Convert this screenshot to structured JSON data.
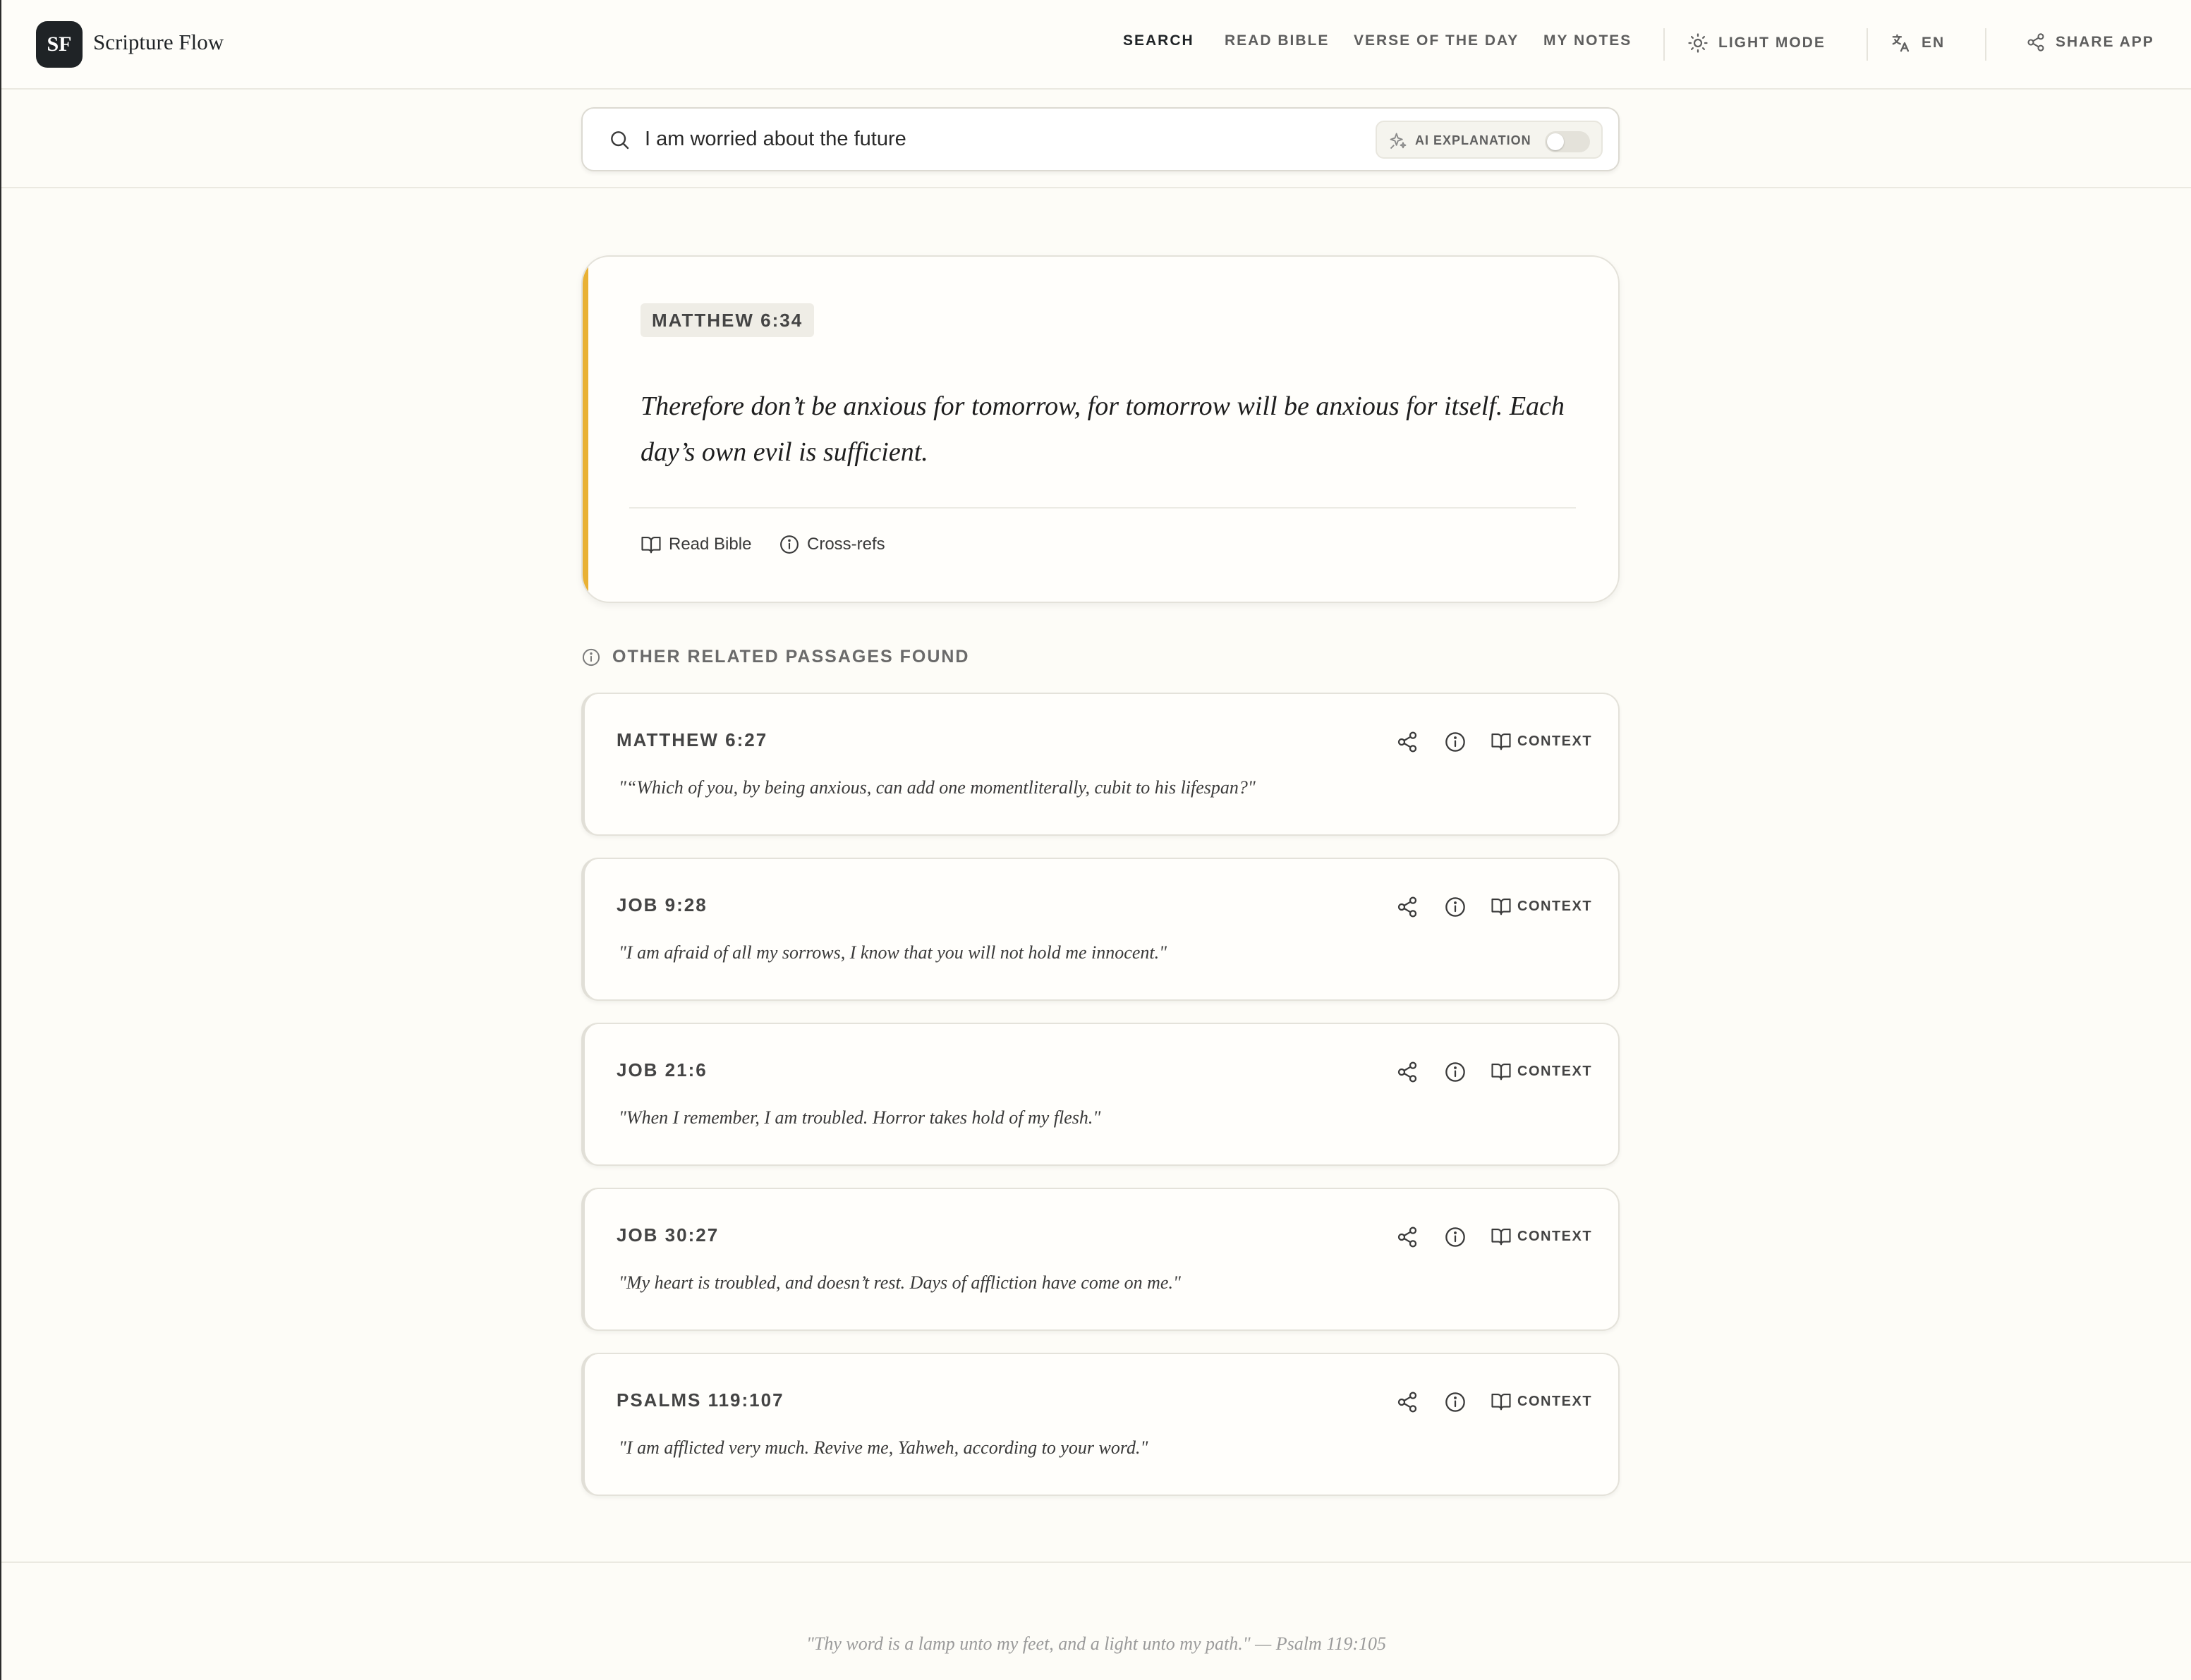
{
  "app": {
    "logo_initials": "SF",
    "name": "Scripture Flow"
  },
  "nav": {
    "search": "SEARCH",
    "read_bible": "READ BIBLE",
    "verse_of_day": "VERSE OF THE DAY",
    "my_notes": "MY NOTES",
    "theme": "LIGHT MODE",
    "language": "EN",
    "share_app": "SHARE APP"
  },
  "search": {
    "query": "I am worried about the future",
    "ai_toggle_label": "AI EXPLANATION",
    "ai_toggle_on": false
  },
  "featured": {
    "reference": "MATTHEW 6:34",
    "text": "Therefore don’t be anxious for tomorrow, for tomorrow will be anxious for itself. Each day’s own evil is sufficient.",
    "read_bible_label": "Read Bible",
    "cross_refs_label": "Cross-refs",
    "accent_color": "#e9b134"
  },
  "related": {
    "heading": "OTHER RELATED PASSAGES FOUND",
    "context_label": "CONTEXT",
    "passages": [
      {
        "reference": "MATTHEW 6:27",
        "text": "\"“Which of you, by being anxious, can add one momentliterally, cubit to his lifespan?\""
      },
      {
        "reference": "JOB 9:28",
        "text": "\"I am afraid of all my sorrows, I know that you will not hold me innocent.\""
      },
      {
        "reference": "JOB 21:6",
        "text": "\"When I remember, I am troubled. Horror takes hold of my flesh.\""
      },
      {
        "reference": "JOB 30:27",
        "text": "\"My heart is troubled, and doesn’t rest. Days of affliction have come on me.\""
      },
      {
        "reference": "PSALMS 119:107",
        "text": "\"I am afflicted very much. Revive me, Yahweh, according to your word.\""
      }
    ]
  },
  "footer": {
    "quote": "\"Thy word is a lamp unto my feet, and a light unto my path.\" — Psalm 119:105"
  }
}
